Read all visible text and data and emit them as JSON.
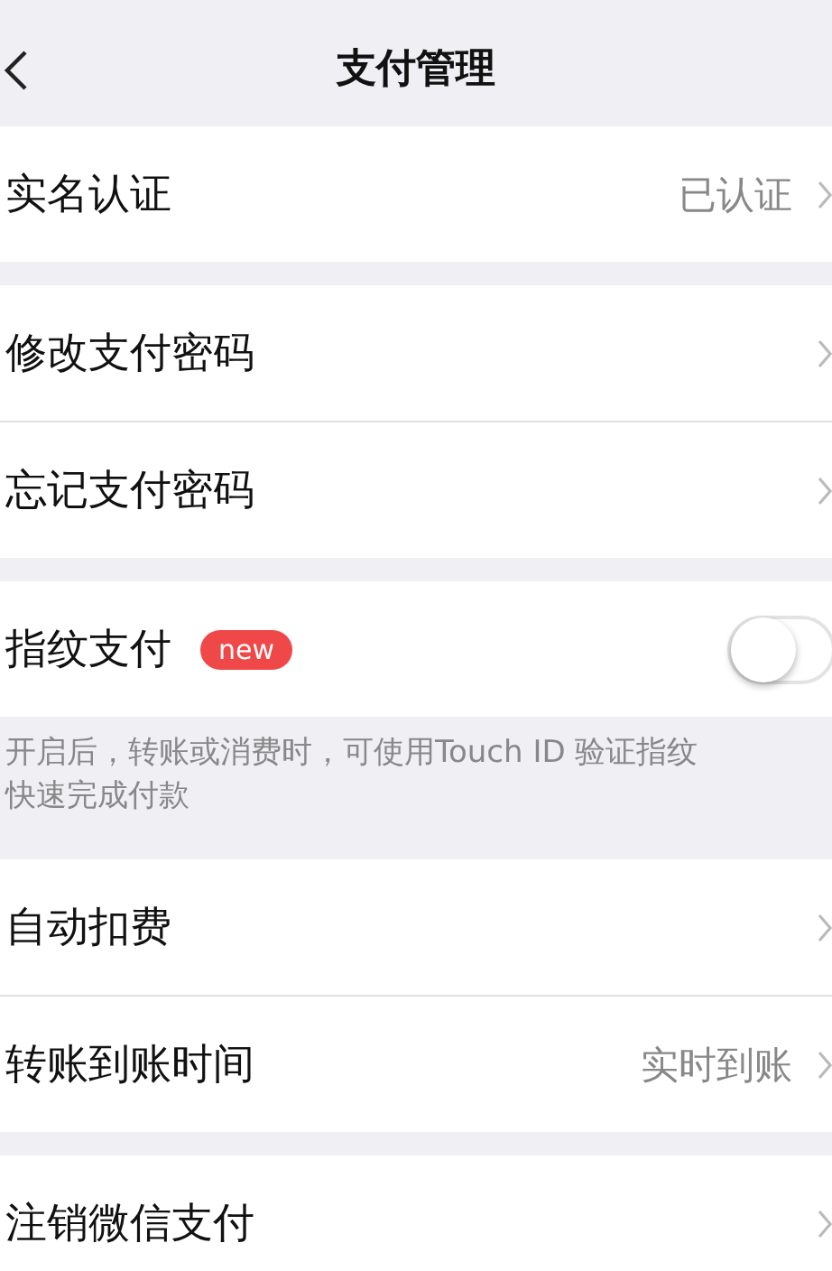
{
  "nav": {
    "title": "支付管理"
  },
  "groups": [
    {
      "rows": [
        {
          "kind": "link",
          "label": "实名认证",
          "value": "已认证"
        }
      ]
    },
    {
      "rows": [
        {
          "kind": "link",
          "label": "修改支付密码"
        },
        {
          "kind": "link",
          "label": "忘记支付密码"
        }
      ]
    },
    {
      "rows": [
        {
          "kind": "switch",
          "label": "指纹支付",
          "badge": "new",
          "on": false
        }
      ],
      "note": [
        "开启后，转账或消费时，可使用Touch ID 验证指纹",
        "快速完成付款"
      ]
    },
    {
      "rows": [
        {
          "kind": "link",
          "label": "自动扣费"
        },
        {
          "kind": "link",
          "label": "转账到账时间",
          "value": "实时到账"
        }
      ]
    },
    {
      "rows": [
        {
          "kind": "link",
          "label": "注销微信支付"
        }
      ]
    }
  ]
}
